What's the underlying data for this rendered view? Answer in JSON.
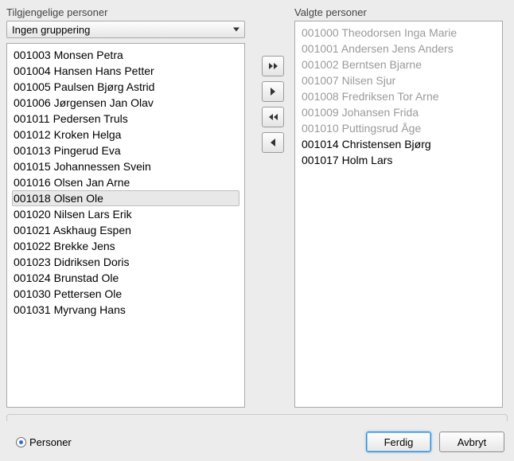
{
  "available": {
    "label": "Tilgjengelige personer",
    "grouping": "Ingen gruppering",
    "items": [
      {
        "text": "001003 Monsen Petra",
        "selected": false
      },
      {
        "text": "001004 Hansen Hans Petter",
        "selected": false
      },
      {
        "text": "001005 Paulsen Bjørg Astrid",
        "selected": false
      },
      {
        "text": "001006 Jørgensen Jan Olav",
        "selected": false
      },
      {
        "text": "001011 Pedersen Truls",
        "selected": false
      },
      {
        "text": "001012 Kroken Helga",
        "selected": false
      },
      {
        "text": "001013 Pingerud Eva",
        "selected": false
      },
      {
        "text": "001015 Johannessen Svein",
        "selected": false
      },
      {
        "text": "001016 Olsen Jan Arne",
        "selected": false
      },
      {
        "text": "001018 Olsen Ole",
        "selected": true
      },
      {
        "text": "001020 Nilsen Lars Erik",
        "selected": false
      },
      {
        "text": "001021 Askhaug Espen",
        "selected": false
      },
      {
        "text": "001022 Brekke Jens",
        "selected": false
      },
      {
        "text": "001023 Didriksen Doris",
        "selected": false
      },
      {
        "text": "001024 Brunstad Ole",
        "selected": false
      },
      {
        "text": "001030 Pettersen Ole",
        "selected": false
      },
      {
        "text": "001031 Myrvang Hans",
        "selected": false
      }
    ]
  },
  "selected": {
    "label": "Valgte personer",
    "items": [
      {
        "text": "001000 Theodorsen Inga Marie",
        "greyed": true
      },
      {
        "text": "001001 Andersen Jens Anders",
        "greyed": true
      },
      {
        "text": "001002 Berntsen Bjarne",
        "greyed": true
      },
      {
        "text": "001007 Nilsen Sjur",
        "greyed": true
      },
      {
        "text": "001008 Fredriksen Tor Arne",
        "greyed": true
      },
      {
        "text": "001009 Johansen Frida",
        "greyed": true
      },
      {
        "text": "001010 Puttingsrud Åge",
        "greyed": true
      },
      {
        "text": "001014 Christensen Bjørg",
        "greyed": false
      },
      {
        "text": "001017 Holm Lars",
        "greyed": false
      }
    ]
  },
  "footer": {
    "radio_label": "Personer",
    "finish": "Ferdig",
    "cancel": "Avbryt"
  }
}
